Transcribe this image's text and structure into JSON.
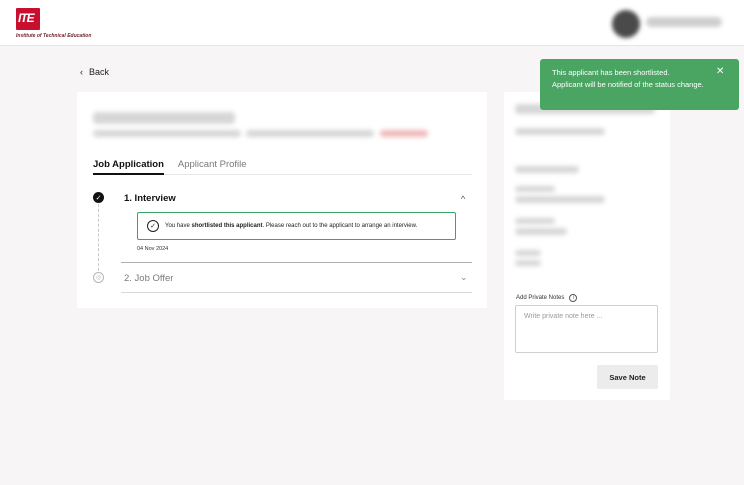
{
  "header": {
    "logo_mark": "ITE",
    "logo_text": "Institute of Technical Education"
  },
  "nav": {
    "back_label": "Back",
    "back_icon": "‹"
  },
  "tabs": [
    {
      "label": "Job Application",
      "active": true
    },
    {
      "label": "Applicant Profile",
      "active": false
    }
  ],
  "steps": {
    "step1": {
      "title": "1. Interview",
      "toggle_icon": "^",
      "notice_prefix": "You have ",
      "notice_bold": "shortlisted this applicant",
      "notice_suffix": ". Please reach out to the applicant to arrange an interview.",
      "date": "04 Nov 2024",
      "status_icon": "✓",
      "notice_icon": "✓"
    },
    "step2": {
      "title": "2. Job Offer",
      "toggle_icon": "⌄",
      "status_icon": "◎"
    }
  },
  "sidebar": {
    "notes_label": "Add Private Notes",
    "info_icon": "i",
    "notes_placeholder": "Write private note here ...",
    "save_label": "Save Note"
  },
  "toast": {
    "line1": "This applicant has been shortlisted.",
    "line2": "Applicant will be notified of the status change.",
    "close_icon": "✕"
  },
  "colors": {
    "brand_red": "#c8102e",
    "toast_green": "#4aa563",
    "notice_border": "#3aa56a",
    "page_bg": "#f8f5f6"
  }
}
